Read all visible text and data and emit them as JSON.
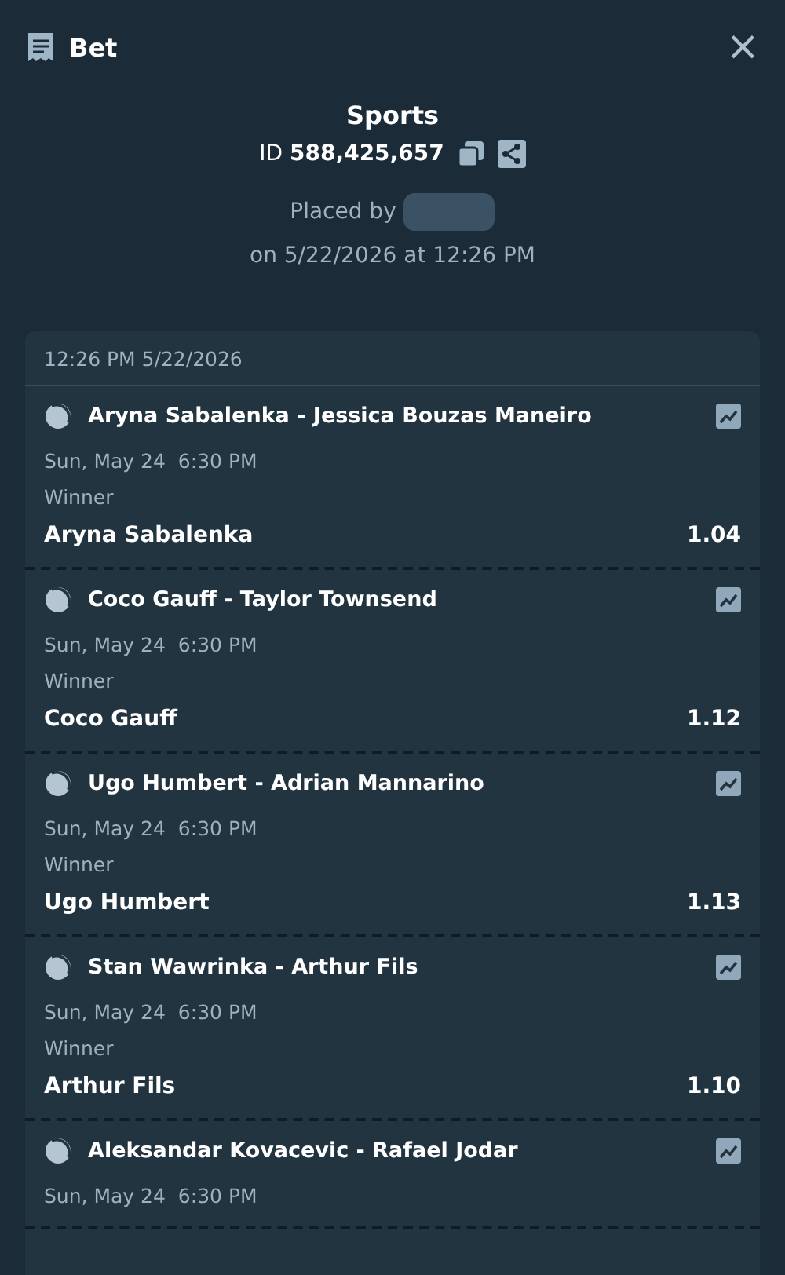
{
  "header": {
    "title": "Bet",
    "close": "×"
  },
  "summary": {
    "category": "Sports",
    "id_label": "ID",
    "id_value": "588,425,657",
    "placed_by": "Placed by",
    "placed_on": "on 5/22/2026 at 12:26 PM"
  },
  "slip": {
    "timestamp": "12:26 PM 5/22/2026",
    "selections": [
      {
        "event": "Aryna Sabalenka - Jessica Bouzas Maneiro",
        "date": "Sun, May 24",
        "time": "6:30 PM",
        "market": "Winner",
        "pick": "Aryna Sabalenka",
        "odds": "1.04"
      },
      {
        "event": "Coco Gauff - Taylor Townsend",
        "date": "Sun, May 24",
        "time": "6:30 PM",
        "market": "Winner",
        "pick": "Coco Gauff",
        "odds": "1.12"
      },
      {
        "event": "Ugo Humbert - Adrian Mannarino",
        "date": "Sun, May 24",
        "time": "6:30 PM",
        "market": "Winner",
        "pick": "Ugo Humbert",
        "odds": "1.13"
      },
      {
        "event": "Stan Wawrinka - Arthur Fils",
        "date": "Sun, May 24",
        "time": "6:30 PM",
        "market": "Winner",
        "pick": "Arthur Fils",
        "odds": "1.10"
      },
      {
        "event": "Aleksandar Kovacevic - Rafael Jodar",
        "date": "Sun, May 24",
        "time": "6:30 PM"
      }
    ]
  }
}
